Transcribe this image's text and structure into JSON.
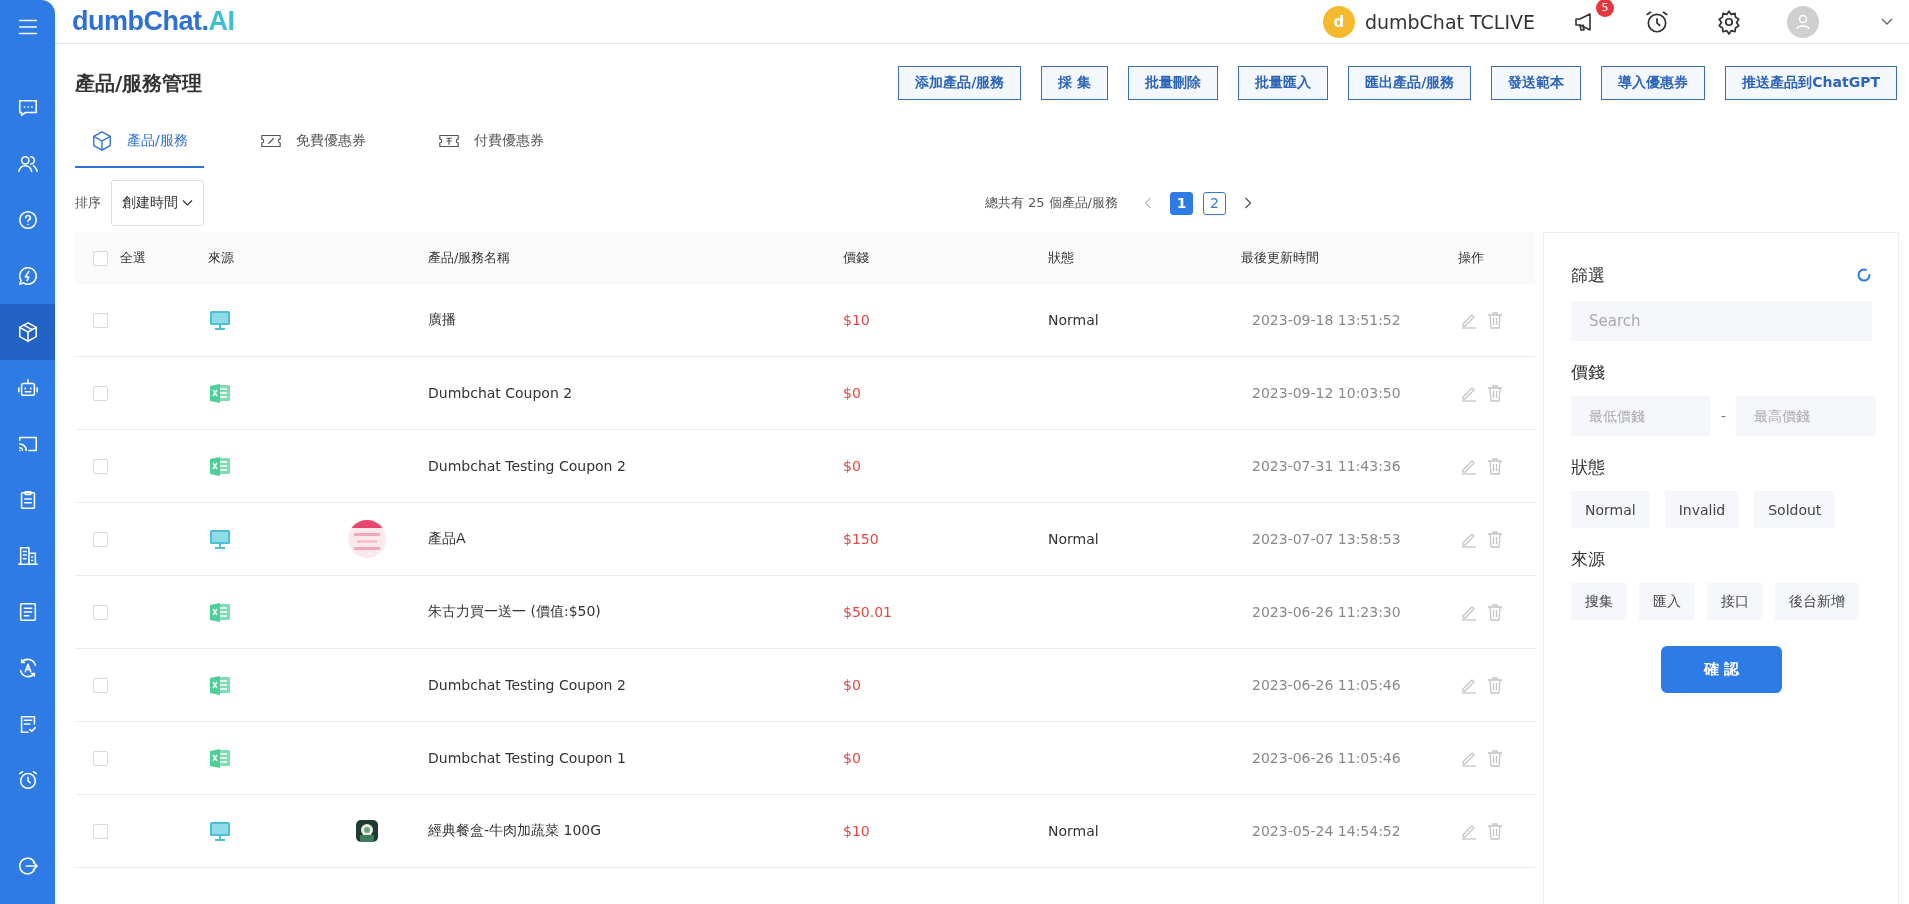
{
  "sidebar": {
    "items": [
      {
        "kind": "menu",
        "selected": false
      },
      {
        "kind": "chat",
        "selected": false
      },
      {
        "kind": "users",
        "selected": false
      },
      {
        "kind": "help",
        "selected": false
      },
      {
        "kind": "bolt",
        "selected": false
      },
      {
        "kind": "box",
        "selected": true
      },
      {
        "kind": "robot",
        "selected": false
      },
      {
        "kind": "cast",
        "selected": false
      },
      {
        "kind": "clipboard",
        "selected": false
      },
      {
        "kind": "building",
        "selected": false
      },
      {
        "kind": "list",
        "selected": false
      },
      {
        "kind": "translate",
        "selected": false
      },
      {
        "kind": "note",
        "selected": false
      },
      {
        "kind": "alarm",
        "selected": false
      },
      {
        "kind": "logout",
        "selected": false
      }
    ]
  },
  "header": {
    "logo": {
      "main": "dumbChat.",
      "accent": "AI"
    },
    "account": {
      "initial": "d",
      "name": "dumbChat TCLIVE"
    },
    "notifications": {
      "count": "5"
    }
  },
  "page": {
    "title": "產品/服務管理",
    "actions": [
      "添加產品/服務",
      "採 集",
      "批量刪除",
      "批量匯入",
      "匯出產品/服務",
      "發送範本",
      "導入優惠券",
      "推送產品到ChatGPT"
    ]
  },
  "tabs": [
    {
      "kind": "box",
      "label": "產品/服務",
      "selected": true
    },
    {
      "kind": "coupon",
      "label": "免費優惠券",
      "selected": false
    },
    {
      "kind": "ticket",
      "label": "付費優惠券",
      "selected": false
    }
  ],
  "sort": {
    "label": "排序",
    "value": "創建時間"
  },
  "pagination": {
    "summary": "總共有 25 個產品/服務",
    "pages": [
      {
        "label": "1",
        "selected": true
      },
      {
        "label": "2",
        "selected": false
      }
    ]
  },
  "table": {
    "select_all": {
      "label": "全選",
      "checked": false
    },
    "columns": [
      "來源",
      "產品/服務名稱",
      "價錢",
      "狀態",
      "最後更新時間",
      "操作"
    ],
    "rows": [
      {
        "checked": false,
        "kind": "screen",
        "name": "廣播",
        "price": "$10",
        "status": "Normal",
        "updated": "2023-09-18 13:51:52"
      },
      {
        "checked": false,
        "kind": "sheet",
        "name": "Dumbchat Coupon 2",
        "price": "$0",
        "updated": "2023-09-12 10:03:50"
      },
      {
        "checked": false,
        "kind": "sheet",
        "name": "Dumbchat Testing Coupon 2",
        "price": "$0",
        "updated": "2023-07-31 11:43:36"
      },
      {
        "checked": false,
        "kind": "screen",
        "name": "產品A",
        "price": "$150",
        "status": "Normal",
        "updated": "2023-07-07 13:58:53"
      },
      {
        "checked": false,
        "kind": "sheet",
        "name": "朱古力買一送一 (價值:$50)",
        "price": "$50.01",
        "updated": "2023-06-26 11:23:30"
      },
      {
        "checked": false,
        "kind": "sheet",
        "name": "Dumbchat Testing Coupon 2",
        "price": "$0",
        "updated": "2023-06-26 11:05:46"
      },
      {
        "checked": false,
        "kind": "sheet",
        "name": "Dumbchat Testing Coupon 1",
        "price": "$0",
        "updated": "2023-06-26 11:05:46"
      },
      {
        "checked": false,
        "kind": "screen",
        "name": "經典餐盒-牛肉加蔬菜 100G",
        "price": "$10",
        "status": "Normal",
        "updated": "2023-05-24 14:54:52"
      }
    ]
  },
  "filter": {
    "title": "篩選",
    "search": {
      "placeholder": "Search"
    },
    "price_label": "價錢",
    "min_price": {
      "placeholder": "最低價錢"
    },
    "separator": "-",
    "max_price": {
      "placeholder": "最高價錢"
    },
    "status_label": "狀態",
    "statuses": [
      {
        "label": "Normal",
        "selected": false
      },
      {
        "label": "Invalid",
        "selected": false
      },
      {
        "label": "Soldout",
        "selected": false
      }
    ],
    "source_label": "來源",
    "sources": [
      {
        "label": "搜集",
        "selected": false
      },
      {
        "label": "匯入",
        "selected": false
      },
      {
        "label": "接口",
        "selected": false
      },
      {
        "label": "後台新增",
        "selected": false
      }
    ],
    "confirm": "確 認"
  }
}
